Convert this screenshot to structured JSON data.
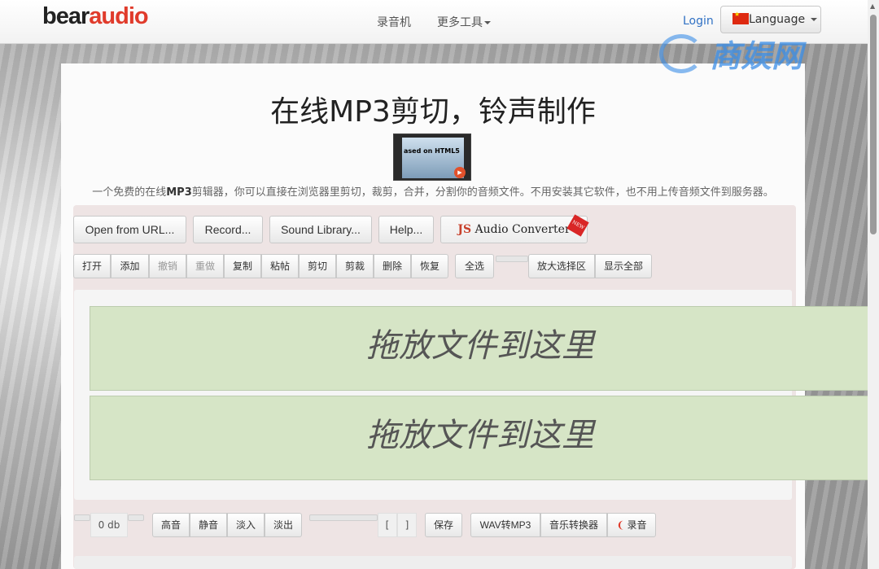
{
  "nav": {
    "logo_part1": "bear",
    "logo_part2": "audio",
    "recorder": "录音机",
    "more_tools": "更多工具",
    "login": "Login",
    "language": "Language"
  },
  "watermark": "商娱网",
  "main": {
    "title": "在线MP3剪切，铃声制作",
    "video_caption": "ased on HTML5",
    "description_pre": "一个免费的在线",
    "description_bold": "MP3",
    "description_post": "剪辑器，你可以直接在浏览器里剪切，裁剪，合并，分割你的音频文件。不用安装其它软件，也不用上传音频文件到服务器。"
  },
  "toolbar_top": {
    "open_url": "Open from URL...",
    "record": "Record...",
    "sound_library": "Sound Library...",
    "help": "Help...",
    "js_prefix": "JS",
    "js_name": "Audio Converter",
    "new_badge": "NEW"
  },
  "edit_buttons": {
    "open": "打开",
    "add": "添加",
    "undo": "撤销",
    "redo": "重做",
    "copy": "复制",
    "paste": "粘帖",
    "cut": "剪切",
    "crop": "剪裁",
    "delete": "删除",
    "restore": "恢复",
    "select_all": "全选",
    "zoom_selection": "放大选择区",
    "show_all": "显示全部"
  },
  "dropzones": [
    "拖放文件到这里",
    "拖放文件到这里"
  ],
  "bottom_toolbar": {
    "volume": "0 db",
    "louder": "高音",
    "mute": "静音",
    "fade_in": "淡入",
    "fade_out": "淡出",
    "bracket_left": "[",
    "bracket_right": "]",
    "save": "保存",
    "wav_to_mp3": "WAV转MP3",
    "music_converter": "音乐转换器",
    "record": "录音"
  }
}
